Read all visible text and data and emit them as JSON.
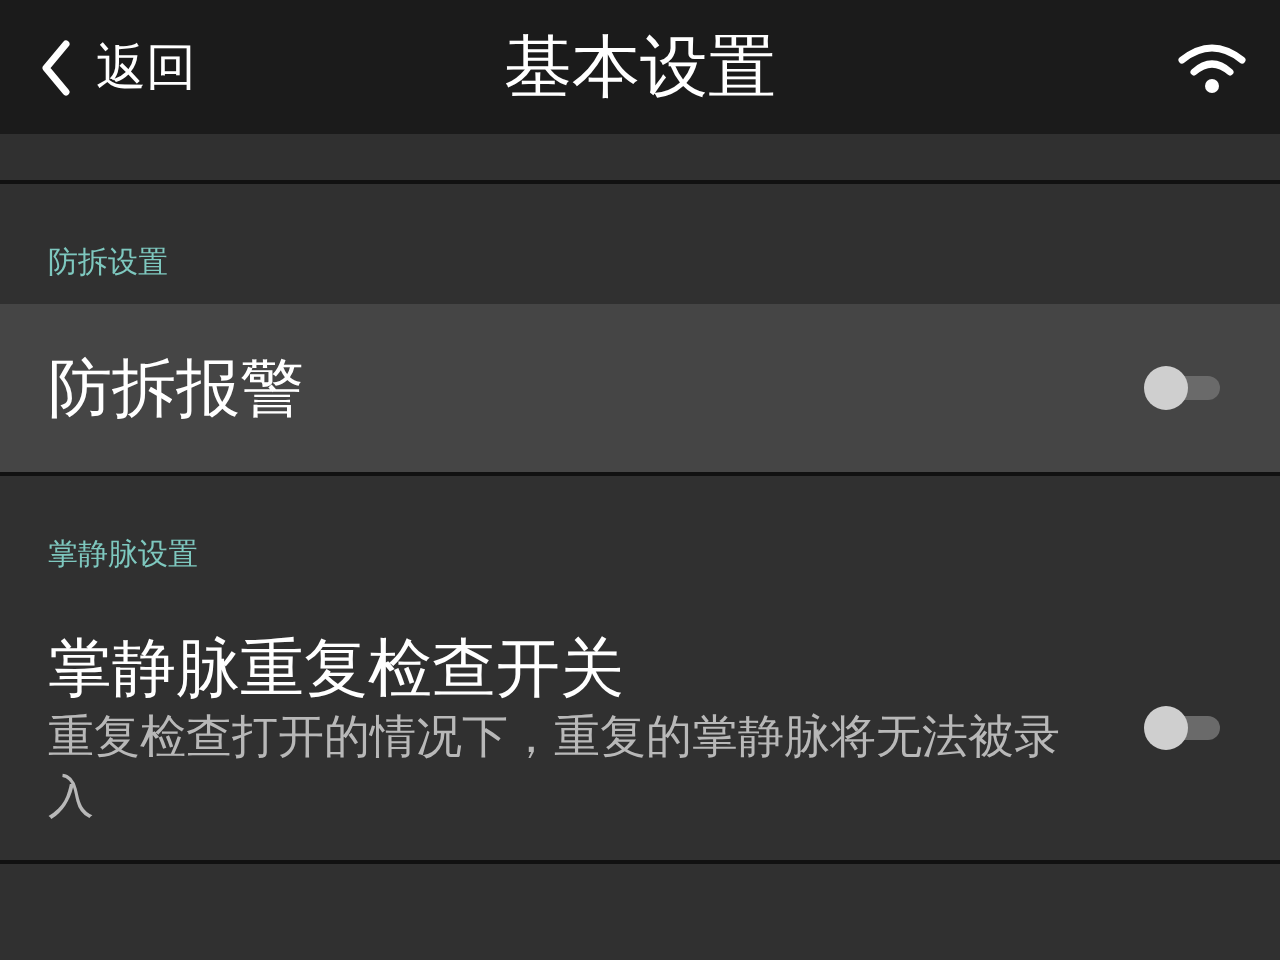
{
  "header": {
    "back_label": "返回",
    "title": "基本设置"
  },
  "sections": [
    {
      "label": "防拆设置",
      "items": [
        {
          "kind": "toggle",
          "title": "防拆报警",
          "on": false,
          "selected": true
        }
      ]
    },
    {
      "label": "掌静脉设置",
      "items": [
        {
          "kind": "toggle",
          "title": "掌静脉重复检查开关",
          "description": "重复检查打开的情况下，重复的掌静脉将无法被录入",
          "on": false,
          "selected": false
        }
      ]
    }
  ]
}
